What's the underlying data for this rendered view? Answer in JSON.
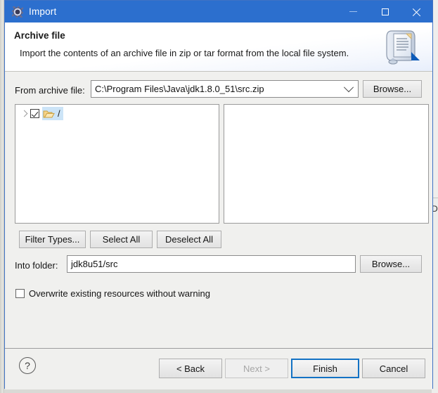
{
  "window": {
    "title": "Import",
    "title_icon": "import-wizard-gear-icon",
    "controls": {
      "minimize": "minimize-icon",
      "maximize": "maximize-icon",
      "close": "close-icon"
    },
    "accent_color": "#2c6fce",
    "border_color": "#3f72c4"
  },
  "header": {
    "title": "Archive file",
    "description": "Import the contents of an archive file in zip or tar format from the local file system.",
    "banner_icon": "archive-import-banner-icon"
  },
  "form": {
    "archive_label": "From archive file:",
    "archive_value": "C:\\Program Files\\Java\\jdk1.8.0_51\\src.zip",
    "archive_dropdown_icon": "chevron-down-icon",
    "archive_browse_label": "Browse...",
    "into_folder_label": "Into folder:",
    "into_folder_value": "jdk8u51/src",
    "into_folder_browse_label": "Browse...",
    "overwrite_label": "Overwrite existing resources without warning",
    "overwrite_checked": false
  },
  "tree": {
    "left": {
      "expander_icon": "chevron-right-icon",
      "checked": true,
      "folder_icon": "open-folder-icon",
      "label": "/",
      "selected": true
    },
    "right": {
      "items": []
    }
  },
  "selection_buttons": {
    "filter_types": "Filter Types...",
    "select_all": "Select All",
    "deselect_all": "Deselect All"
  },
  "footer": {
    "help_icon": "help-question-icon",
    "back": "< Back",
    "next": "Next >",
    "next_enabled": false,
    "finish": "Finish",
    "finish_is_default": true,
    "cancel": "Cancel"
  },
  "background": {
    "right_sliver_glyph": "D"
  }
}
